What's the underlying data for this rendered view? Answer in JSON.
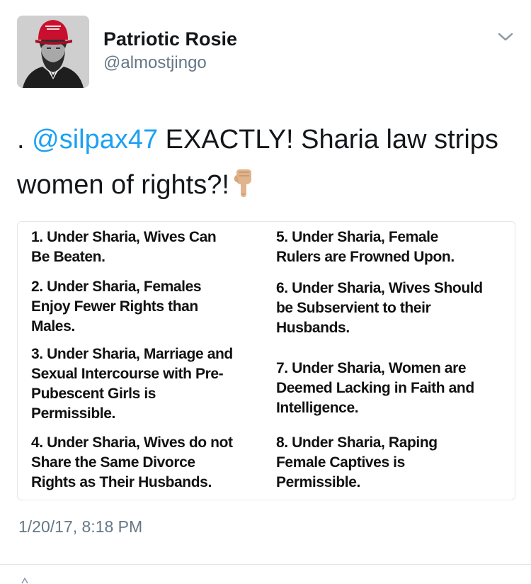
{
  "user": {
    "display_name": "Patriotic Rosie",
    "handle": "@almostjingo"
  },
  "tweet": {
    "prefix": ". ",
    "mention": "@silpax47",
    "text_line1": " EXACTLY! Sharia law strips",
    "text_line2": "women of rights?!",
    "emoji": "pointing-down-hand-icon"
  },
  "image_list": {
    "left": [
      "1. Under Sharia, Wives Can\nBe Beaten.",
      "2. Under Sharia, Females\nEnjoy Fewer Rights than\nMales.",
      "3. Under Sharia, Marriage and\nSexual Intercourse with Pre-\nPubescent Girls is\nPermissible.",
      "4. Under Sharia, Wives do not\nShare the Same Divorce\nRights as Their Husbands."
    ],
    "right": [
      "5. Under Sharia, Female\nRulers are Frowned Upon.",
      "6. Under Sharia, Wives Should\nbe Subservient to their\nHusbands.",
      "7. Under Sharia, Women are\nDeemed Lacking in Faith and\nIntelligence.",
      "8. Under Sharia, Raping\nFemale Captives is\nPermissible."
    ]
  },
  "timestamp": "1/20/17, 8:18 PM",
  "colors": {
    "link": "#1da1f2",
    "secondary_text": "#657786",
    "border": "#e1e8ed"
  }
}
